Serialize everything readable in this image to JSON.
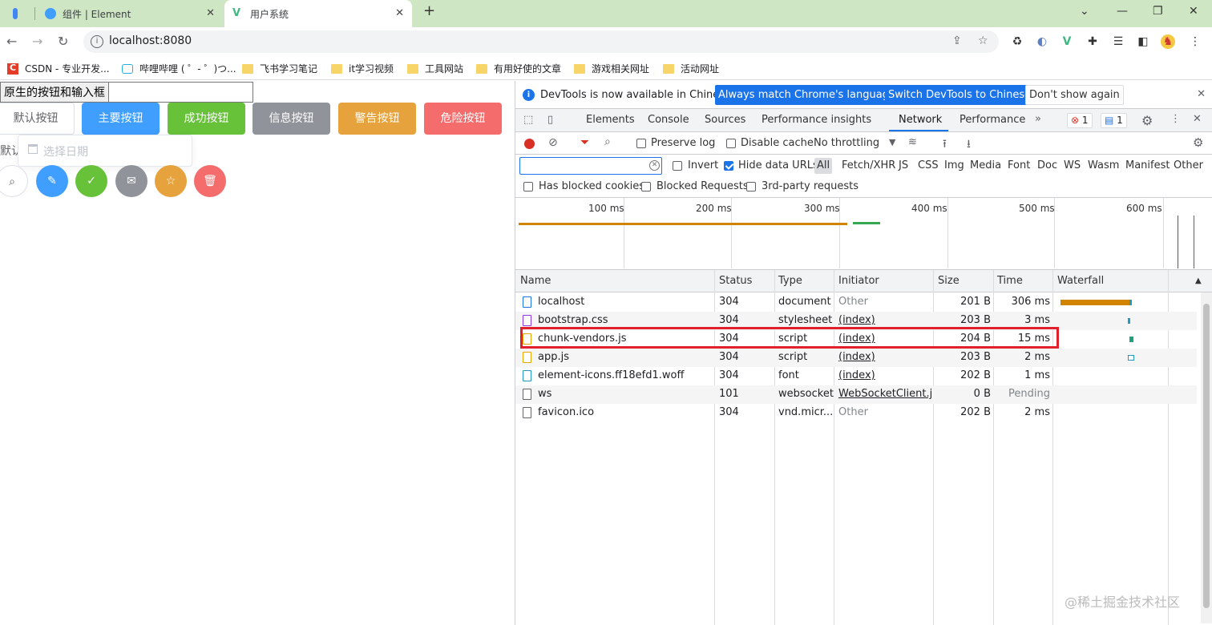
{
  "browser": {
    "tabs": [
      {
        "label": ""
      },
      {
        "label": "组件 | Element"
      },
      {
        "label": "用户系统"
      }
    ],
    "url": "localhost:8080",
    "bookmarks": [
      "CSDN - 专业开发...",
      "哔哩哔哩 ( ゜- ゜)つ...",
      "飞书学习笔记",
      "it学习视频",
      "工具网站",
      "有用好使的文章",
      "游戏相关网址",
      "活动网址"
    ]
  },
  "page": {
    "native_button": "原生的按钮和输入框",
    "buttons": [
      "默认按钮",
      "主要按钮",
      "成功按钮",
      "信息按钮",
      "警告按钮",
      "危险按钮"
    ],
    "clipped_label": "默认",
    "date_placeholder": "选择日期"
  },
  "devtools": {
    "info_message": "DevTools is now available in Chinese!",
    "btn_match": "Always match Chrome's language",
    "btn_switch": "Switch DevTools to Chinese",
    "btn_dont_show": "Don't show again",
    "tabs": [
      "Elements",
      "Console",
      "Sources",
      "Performance insights",
      "Network",
      "Performance"
    ],
    "error_count": "1",
    "message_count": "1",
    "preserve_log": "Preserve log",
    "disable_cache": "Disable cache",
    "throttling": "No throttling",
    "invert": "Invert",
    "hide_data_urls": "Hide data URLs",
    "filter_types": [
      "All",
      "Fetch/XHR",
      "JS",
      "CSS",
      "Img",
      "Media",
      "Font",
      "Doc",
      "WS",
      "Wasm",
      "Manifest",
      "Other"
    ],
    "has_blocked_cookies": "Has blocked cookies",
    "blocked_requests": "Blocked Requests",
    "third_party": "3rd-party requests",
    "overview_ticks": [
      "100 ms",
      "200 ms",
      "300 ms",
      "400 ms",
      "500 ms",
      "600 ms"
    ],
    "columns": [
      "Name",
      "Status",
      "Type",
      "Initiator",
      "Size",
      "Time",
      "Waterfall"
    ],
    "rows": [
      {
        "name": "localhost",
        "status": "304",
        "type": "document",
        "initiator": "Other",
        "size": "201 B",
        "time": "306 ms"
      },
      {
        "name": "bootstrap.css",
        "status": "304",
        "type": "stylesheet",
        "initiator": "(index)",
        "size": "203 B",
        "time": "3 ms"
      },
      {
        "name": "chunk-vendors.js",
        "status": "304",
        "type": "script",
        "initiator": "(index)",
        "size": "204 B",
        "time": "15 ms"
      },
      {
        "name": "app.js",
        "status": "304",
        "type": "script",
        "initiator": "(index)",
        "size": "203 B",
        "time": "2 ms"
      },
      {
        "name": "element-icons.ff18efd1.woff",
        "status": "304",
        "type": "font",
        "initiator": "(index)",
        "size": "202 B",
        "time": "1 ms"
      },
      {
        "name": "ws",
        "status": "101",
        "type": "websocket",
        "initiator": "WebSocketClient.j...",
        "size": "0 B",
        "time": "Pending"
      },
      {
        "name": "favicon.ico",
        "status": "304",
        "type": "vnd.micr...",
        "initiator": "Other",
        "size": "202 B",
        "time": "2 ms"
      }
    ]
  },
  "watermark": "@稀土掘金技术社区",
  "colors": {
    "primary": "#409eff",
    "success": "#67c23a",
    "info": "#909399",
    "warning": "#e6a23c",
    "danger": "#f56c6c",
    "highlight": "#e0202a",
    "devtools_accent": "#1a73e8"
  }
}
